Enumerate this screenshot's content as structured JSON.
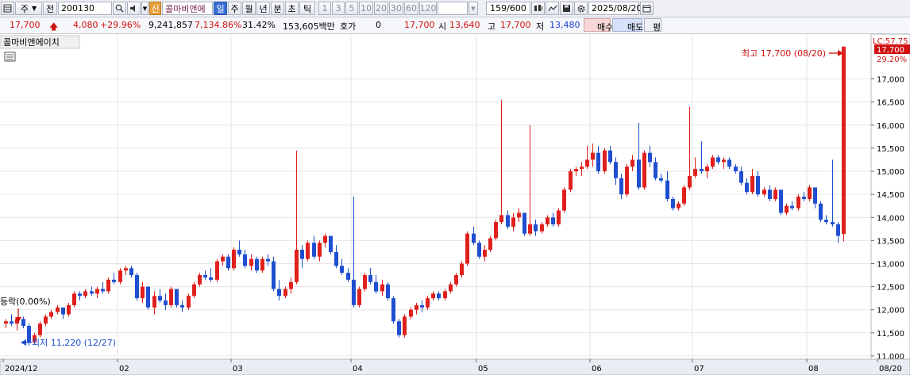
{
  "toolbar": {
    "market_label": "주",
    "prefix_label": "전",
    "code": "200130",
    "new_badge": "신",
    "stock_name": "콜마비앤에",
    "period_tabs": [
      "일",
      "주",
      "월",
      "년",
      "분",
      "초",
      "틱"
    ],
    "active_period": "일",
    "intervals": [
      "1",
      "3",
      "5",
      "10",
      "20",
      "30",
      "60",
      "120"
    ],
    "count": "159/600",
    "date": "2025/08/20"
  },
  "quote": {
    "price": "17,700",
    "change": "4,080",
    "change_pct": "+29.96%",
    "volume": "9,241,857",
    "volume_ratio": "7,134.86%",
    "turnover": "31.42%",
    "amount": "153,605백만",
    "hoga_label": "호가",
    "hoga_value": "0",
    "ask_price": "17,700",
    "open_label": "시",
    "open": "13,640",
    "high_label": "고",
    "high": "17,700",
    "low_label": "저",
    "low": "13,480",
    "buy_label": "매수",
    "sell_label": "매도",
    "avg_label": "평"
  },
  "chart_title": "콜마비앤에이치",
  "annotations": {
    "high": "최고 17,700 (08/20)",
    "low": "최저 11,220 (12/27)",
    "side": "등락(0.00%)",
    "lc": "LC:57.75",
    "last_price": "17,700",
    "last_pct": "29.20%"
  },
  "colors": {
    "up": "#e0201c",
    "down": "#1f4fd0",
    "grid": "#e6e6e6"
  },
  "chart_data": {
    "type": "candlestick",
    "y_ticks": [
      11000,
      11500,
      12000,
      12500,
      13000,
      13500,
      14000,
      14500,
      15000,
      15500,
      16000,
      16500,
      17000
    ],
    "y_range": [
      10930,
      17800
    ],
    "x_labels": [
      "2024/12",
      "02",
      "03",
      "04",
      "05",
      "06",
      "07",
      "08",
      "08/20"
    ],
    "candles": [
      [
        11700,
        11800,
        11600,
        11750
      ],
      [
        11750,
        11900,
        11650,
        11700
      ],
      [
        11700,
        11800,
        11550,
        11800
      ],
      [
        11800,
        11850,
        11600,
        11650
      ],
      [
        11650,
        11700,
        11220,
        11300
      ],
      [
        11300,
        11500,
        11250,
        11450
      ],
      [
        11450,
        11750,
        11400,
        11700
      ],
      [
        11700,
        11900,
        11650,
        11850
      ],
      [
        11850,
        12000,
        11800,
        11950
      ],
      [
        11950,
        12100,
        11900,
        12050
      ],
      [
        12050,
        11950,
        11800,
        11900
      ],
      [
        11900,
        12150,
        11850,
        12100
      ],
      [
        12100,
        12400,
        12050,
        12350
      ],
      [
        12350,
        12400,
        12200,
        12300
      ],
      [
        12300,
        12450,
        12250,
        12400
      ],
      [
        12400,
        12500,
        12300,
        12350
      ],
      [
        12350,
        12500,
        12250,
        12450
      ],
      [
        12450,
        12600,
        12350,
        12400
      ],
      [
        12400,
        12700,
        12350,
        12650
      ],
      [
        12650,
        12800,
        12550,
        12600
      ],
      [
        12600,
        12900,
        12550,
        12850
      ],
      [
        12850,
        12950,
        12750,
        12900
      ],
      [
        12900,
        12950,
        12700,
        12750
      ],
      [
        12750,
        12800,
        12200,
        12250
      ],
      [
        12250,
        12600,
        12150,
        12500
      ],
      [
        12500,
        12500,
        12000,
        12050
      ],
      [
        12050,
        12400,
        11900,
        12300
      ],
      [
        12300,
        12450,
        12150,
        12200
      ],
      [
        12200,
        12350,
        12000,
        12100
      ],
      [
        12100,
        12500,
        12050,
        12450
      ],
      [
        12450,
        12300,
        12050,
        12100
      ],
      [
        12100,
        12200,
        11950,
        12050
      ],
      [
        12050,
        12350,
        12000,
        12300
      ],
      [
        12300,
        12600,
        12250,
        12550
      ],
      [
        12550,
        12800,
        12500,
        12750
      ],
      [
        12750,
        12850,
        12650,
        12700
      ],
      [
        12700,
        12900,
        12600,
        12650
      ],
      [
        12650,
        13100,
        12600,
        13050
      ],
      [
        13050,
        13200,
        12950,
        13150
      ],
      [
        13150,
        13200,
        12850,
        12900
      ],
      [
        12900,
        13350,
        12850,
        13300
      ],
      [
        13300,
        13500,
        13150,
        13200
      ],
      [
        13200,
        13300,
        12900,
        12950
      ],
      [
        12950,
        13200,
        12850,
        13100
      ],
      [
        13100,
        13150,
        12800,
        12850
      ],
      [
        12850,
        13150,
        12800,
        13100
      ],
      [
        13100,
        13200,
        12950,
        13050
      ],
      [
        13050,
        13150,
        12400,
        12450
      ],
      [
        12450,
        12650,
        12200,
        12300
      ],
      [
        12300,
        12500,
        12250,
        12450
      ],
      [
        12450,
        12700,
        12350,
        12600
      ],
      [
        12600,
        15450,
        12550,
        13300
      ],
      [
        13300,
        13400,
        12900,
        13100
      ],
      [
        13100,
        13500,
        13050,
        13450
      ],
      [
        13450,
        13600,
        13100,
        13150
      ],
      [
        13150,
        13500,
        13050,
        13450
      ],
      [
        13450,
        13650,
        13350,
        13600
      ],
      [
        13600,
        13400,
        13200,
        13250
      ],
      [
        13250,
        13400,
        12900,
        12950
      ],
      [
        12950,
        13100,
        12750,
        12800
      ],
      [
        12800,
        12900,
        12600,
        12650
      ],
      [
        12650,
        14450,
        12050,
        12100
      ],
      [
        12100,
        12500,
        12050,
        12450
      ],
      [
        12450,
        12800,
        12400,
        12750
      ],
      [
        12750,
        12900,
        12550,
        12600
      ],
      [
        12600,
        12750,
        12350,
        12400
      ],
      [
        12400,
        12650,
        12300,
        12550
      ],
      [
        12550,
        12600,
        12200,
        12250
      ],
      [
        12250,
        12300,
        11700,
        11750
      ],
      [
        11750,
        11800,
        11400,
        11450
      ],
      [
        11450,
        11900,
        11400,
        11850
      ],
      [
        11850,
        12050,
        11800,
        12000
      ],
      [
        12000,
        12150,
        11900,
        12100
      ],
      [
        12100,
        12200,
        11950,
        12050
      ],
      [
        12050,
        12300,
        12000,
        12250
      ],
      [
        12250,
        12400,
        12200,
        12350
      ],
      [
        12350,
        12400,
        12200,
        12250
      ],
      [
        12250,
        12450,
        12200,
        12400
      ],
      [
        12400,
        12600,
        12350,
        12550
      ],
      [
        12550,
        12800,
        12500,
        12750
      ],
      [
        12750,
        13050,
        12700,
        13000
      ],
      [
        13000,
        13700,
        12950,
        13650
      ],
      [
        13650,
        13800,
        13400,
        13450
      ],
      [
        13450,
        13500,
        13100,
        13150
      ],
      [
        13150,
        13400,
        13050,
        13300
      ],
      [
        13300,
        13600,
        13250,
        13550
      ],
      [
        13550,
        13950,
        13500,
        13900
      ],
      [
        13900,
        16550,
        13850,
        14050
      ],
      [
        14050,
        14150,
        13750,
        13800
      ],
      [
        13800,
        14100,
        13700,
        14000
      ],
      [
        14000,
        14200,
        13900,
        14100
      ],
      [
        14100,
        14050,
        13600,
        13650
      ],
      [
        13650,
        16000,
        13600,
        13850
      ],
      [
        13850,
        13950,
        13600,
        13700
      ],
      [
        13700,
        13900,
        13650,
        13850
      ],
      [
        13850,
        14050,
        13800,
        14000
      ],
      [
        14000,
        14100,
        13800,
        13850
      ],
      [
        13850,
        14200,
        13800,
        14150
      ],
      [
        14150,
        14650,
        14100,
        14600
      ],
      [
        14600,
        15050,
        14550,
        15000
      ],
      [
        15000,
        15100,
        14900,
        15050
      ],
      [
        15050,
        15200,
        14900,
        15100
      ],
      [
        15100,
        15550,
        15050,
        15250
      ],
      [
        15250,
        15600,
        15100,
        15400
      ],
      [
        15400,
        15550,
        14950,
        15000
      ],
      [
        15000,
        15500,
        14950,
        15450
      ],
      [
        15450,
        15550,
        15150,
        15200
      ],
      [
        15200,
        15300,
        14700,
        14850
      ],
      [
        14850,
        14950,
        14400,
        14500
      ],
      [
        14500,
        15150,
        14450,
        15100
      ],
      [
        15100,
        15350,
        15000,
        15250
      ],
      [
        15250,
        16050,
        14600,
        14650
      ],
      [
        14650,
        15450,
        14600,
        15400
      ],
      [
        15400,
        15550,
        15100,
        15200
      ],
      [
        15200,
        15300,
        14800,
        14850
      ],
      [
        14850,
        14950,
        14750,
        14800
      ],
      [
        14800,
        15000,
        14350,
        14400
      ],
      [
        14400,
        14450,
        14150,
        14200
      ],
      [
        14200,
        14350,
        14150,
        14300
      ],
      [
        14300,
        14700,
        14250,
        14650
      ],
      [
        14650,
        16400,
        14600,
        14900
      ],
      [
        14900,
        15300,
        14850,
        15050
      ],
      [
        15050,
        15650,
        14950,
        15000
      ],
      [
        15000,
        15150,
        14850,
        15100
      ],
      [
        15100,
        15350,
        15050,
        15300
      ],
      [
        15300,
        15350,
        15150,
        15200
      ],
      [
        15200,
        15300,
        15050,
        15250
      ],
      [
        15250,
        15300,
        15050,
        15100
      ],
      [
        15100,
        15150,
        14950,
        15000
      ],
      [
        15000,
        15100,
        14700,
        14750
      ],
      [
        14750,
        14850,
        14500,
        14550
      ],
      [
        14550,
        15050,
        14500,
        14900
      ],
      [
        14900,
        15000,
        14450,
        14500
      ],
      [
        14500,
        14650,
        14450,
        14600
      ],
      [
        14600,
        14700,
        14350,
        14400
      ],
      [
        14400,
        14650,
        14350,
        14600
      ],
      [
        14600,
        14450,
        14050,
        14100
      ],
      [
        14100,
        14300,
        14050,
        14250
      ],
      [
        14250,
        14350,
        14150,
        14200
      ],
      [
        14200,
        14500,
        14150,
        14450
      ],
      [
        14450,
        14550,
        14350,
        14400
      ],
      [
        14400,
        14700,
        14350,
        14650
      ],
      [
        14650,
        14500,
        14200,
        14300
      ],
      [
        14300,
        14350,
        13900,
        13950
      ],
      [
        13950,
        14050,
        13850,
        13900
      ],
      [
        13900,
        15250,
        13800,
        13850
      ],
      [
        13850,
        13900,
        13450,
        13600
      ],
      [
        13640,
        17700,
        13480,
        17700
      ]
    ]
  }
}
